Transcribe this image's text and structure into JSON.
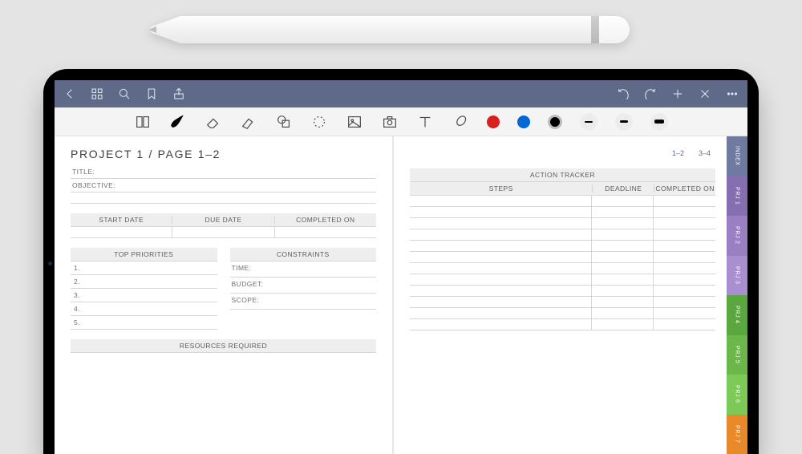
{
  "appbar": {
    "icons": [
      "back",
      "apps",
      "search",
      "bookmark",
      "share",
      "undo",
      "redo",
      "add",
      "close",
      "more"
    ]
  },
  "toolstrip": {
    "tools": [
      "page-view",
      "pen",
      "eraser",
      "highlighter",
      "shapes",
      "lasso",
      "image",
      "camera",
      "text",
      "link"
    ],
    "swatches": [
      "#d9201f",
      "#0067d7",
      "#000000"
    ],
    "stroke_sizes": [
      1,
      2,
      3
    ]
  },
  "breadcrumb": "PROJECT 1 / PAGE 1–2",
  "page_links": {
    "current": "1–2",
    "next": "3–4"
  },
  "left": {
    "title_label": "TITLE:",
    "objective_label": "OBJECTIVE:",
    "dates": {
      "start": "START DATE",
      "due": "DUE DATE",
      "completed": "COMPLETED ON"
    },
    "priorities_header": "TOP PRIORITIES",
    "priorities": [
      "1.",
      "2.",
      "3.",
      "4.",
      "5."
    ],
    "constraints_header": "CONSTRAINTS",
    "constraints": {
      "time": "TIME:",
      "budget": "BUDGET:",
      "scope": "SCOPE:"
    },
    "resources_header": "RESOURCES REQUIRED"
  },
  "right": {
    "tracker_header": "ACTION TRACKER",
    "cols": {
      "steps": "STEPS",
      "deadline": "DEADLINE",
      "completed": "COMPLETED ON"
    }
  },
  "tabs": [
    {
      "label": "INDEX",
      "color": "#6e7aa0"
    },
    {
      "label": "PRJ 1",
      "color": "#856fb0"
    },
    {
      "label": "PRJ 2",
      "color": "#9a7fc2"
    },
    {
      "label": "PRJ 3",
      "color": "#a98fcf"
    },
    {
      "label": "PRJ 4",
      "color": "#5aa63f"
    },
    {
      "label": "PRJ 5",
      "color": "#6bb74a"
    },
    {
      "label": "PRJ 6",
      "color": "#7cc957"
    },
    {
      "label": "PRJ 7",
      "color": "#e88a2a"
    }
  ]
}
